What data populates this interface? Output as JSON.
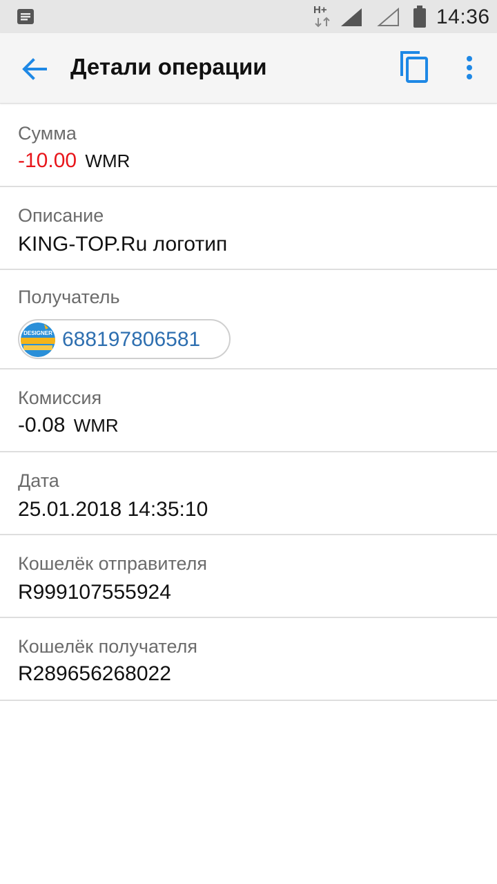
{
  "status_bar": {
    "network": "H+",
    "time": "14:36"
  },
  "app_bar": {
    "title": "Детали операции"
  },
  "details": {
    "amount": {
      "label": "Сумма",
      "value": "-10.00",
      "currency": "WMR"
    },
    "description": {
      "label": "Описание",
      "value": "KING-TOP.Ru логотип"
    },
    "recipient": {
      "label": "Получатель",
      "id": "688197806581",
      "avatar_text": "DESIGNER"
    },
    "commission": {
      "label": "Комиссия",
      "value": "-0.08",
      "currency": "WMR"
    },
    "date": {
      "label": "Дата",
      "value": "25.01.2018 14:35:10"
    },
    "sender_wallet": {
      "label": "Кошелёк отправителя",
      "value": "R999107555924"
    },
    "recipient_wallet": {
      "label": "Кошелёк получателя",
      "value": "R289656268022"
    }
  },
  "colors": {
    "accent": "#1e88e5",
    "negative_amount": "#e8161b",
    "link": "#2e6fb0"
  }
}
